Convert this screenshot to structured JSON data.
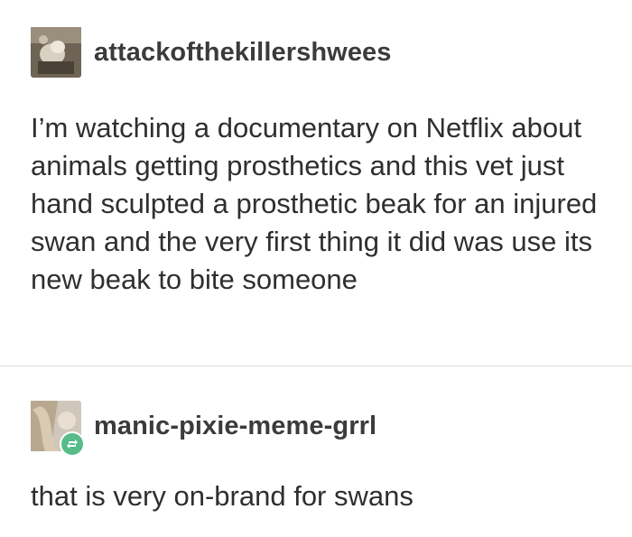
{
  "posts": [
    {
      "username": "attackofthekillershwees",
      "text": "I’m watching a documentary on Netflix about animals getting prosthetics and this vet just hand sculpted a prosthetic beak for an injured swan and the very first thing it did was use its new beak to bite someone",
      "avatar": "avatar-photo-icon"
    },
    {
      "username": "manic-pixie-meme-grrl",
      "text": "that is very on-brand for swans",
      "avatar": "avatar-photo-icon",
      "badge": "reblog-icon",
      "badge_color": "#56bc8a"
    }
  ]
}
